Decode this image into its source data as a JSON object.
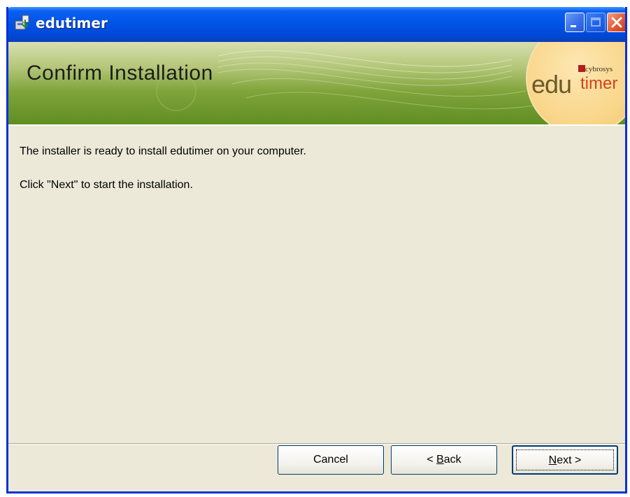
{
  "window": {
    "title": "edutimer"
  },
  "banner": {
    "title": "Confirm Installation",
    "logo_prefix": "edu",
    "logo_suffix": "timer",
    "logo_brand": "cybrosys"
  },
  "content": {
    "line1": "The installer is ready to install edutimer on your computer.",
    "line2": "Click \"Next\" to start the installation."
  },
  "buttons": {
    "cancel": "Cancel",
    "back_prefix": "< ",
    "back_access": "B",
    "back_rest": "ack",
    "next_access": "N",
    "next_rest": "ext >"
  },
  "icons": {
    "app": "installer-icon",
    "minimize": "minimize-icon",
    "maximize": "maximize-icon",
    "close": "close-icon"
  },
  "colors": {
    "titlebar": "#0053e6",
    "banner_green": "#7fa43a",
    "dialog_bg": "#ece9d8",
    "close_button": "#e5603b"
  }
}
